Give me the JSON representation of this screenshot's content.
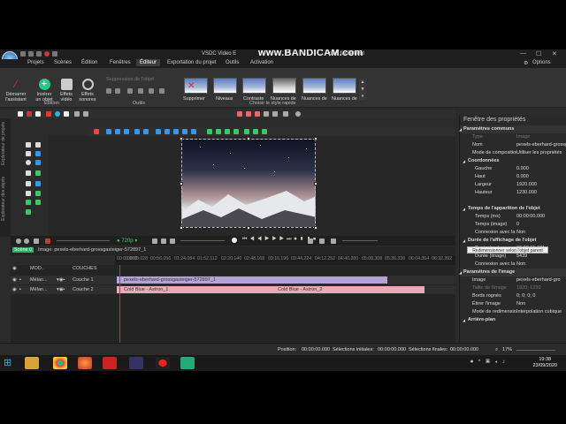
{
  "window": {
    "title": "VSDC Video E",
    "watermark": "www.BANDICAM.com",
    "title_suffix": "plus facilement"
  },
  "menu_tabs": [
    "Projets",
    "Scènes",
    "Édition",
    "Fenêtres",
    "Éditeur",
    "Exportation du projet",
    "Outils",
    "Activation"
  ],
  "support_label": "Options",
  "ribbon": {
    "buttons": [
      {
        "label": "Démarrer\nl'assistant",
        "color": "#d33"
      },
      {
        "label": "Insérer\nun objet",
        "color": "#2c8"
      },
      {
        "label": "Effets\nvidéo",
        "color": "#ccc"
      },
      {
        "label": "Effets\nsonores",
        "color": "#ccc"
      }
    ],
    "group_edition": "Édition",
    "group_outils": "Outils",
    "group_style": "Choisir le style rapide",
    "prop_hint": "Suppression de l'objet",
    "styles": [
      {
        "label": "Supprimer",
        "gray": false
      },
      {
        "label": "Niveaux",
        "gray": false
      },
      {
        "label": "Contraste",
        "gray": false
      },
      {
        "label": "Nuances de",
        "gray": true
      },
      {
        "label": "Nuances de",
        "gray": false
      },
      {
        "label": "Nuances de",
        "gray": false
      }
    ]
  },
  "left_panel": {
    "vertical_tabs": [
      "Explorateur de projets",
      "Explorateur des objets"
    ]
  },
  "playback": {
    "zoom": "720p"
  },
  "scene_tabs": {
    "scene": "Scène 0",
    "image": "Image: pexels-eberhard-grossgasteiger-572897_1"
  },
  "ruler_ticks": [
    "00:00.000",
    "00:08.028",
    "00:56.056",
    "01:24.084",
    "01:52.112",
    "02:20.140",
    "02:48.168",
    "03:16.196",
    "03:44.224",
    "04:12.252",
    "04:40.280",
    "05:08.308",
    "05:36.336",
    "06:04.364",
    "06:32.392"
  ],
  "timeline": {
    "header": {
      "mode": "MOD..",
      "layers": "COUCHES"
    },
    "rows": [
      {
        "type": "Mélan...",
        "name": "Couche 1"
      },
      {
        "type": "Mélan...",
        "name": "Couche 2"
      }
    ],
    "clips": {
      "image": "pexels-eberhard-grossgasteiger-572897_1",
      "audio1": "Cold Blue - Astron_1",
      "audio2": "Cold Blue - Astron_2"
    }
  },
  "status": {
    "position_label": "Position:",
    "position_value": "00:00:00.000",
    "sel_start_label": "Sélections initiales:",
    "sel_start_value": "00:00:00.000",
    "sel_end_label": "Sélections finales:",
    "sel_end_value": "00:00:00.000",
    "zoom": "17%"
  },
  "properties": {
    "title": "Fenêtre des propriétés",
    "rows": [
      {
        "kind": "sec",
        "k": "Paramètres communs",
        "v": ""
      },
      {
        "kind": "dim",
        "k": "Type",
        "v": "Image"
      },
      {
        "kind": "",
        "k": "Nom",
        "v": "pexels-eberhard-grossg"
      },
      {
        "kind": "",
        "k": "Mode de composition",
        "v": "Utiliser les propriétés"
      },
      {
        "kind": "sub",
        "k": "Coordonnées",
        "v": ""
      },
      {
        "kind": "ind",
        "k": "Gauche",
        "v": "0.000"
      },
      {
        "kind": "ind",
        "k": "Haut",
        "v": "0.000"
      },
      {
        "kind": "ind",
        "k": "Largeur",
        "v": "1920.000"
      },
      {
        "kind": "ind",
        "k": "Hauteur",
        "v": "1230.000"
      },
      {
        "kind": "btn",
        "k": "",
        "v": ""
      },
      {
        "kind": "sub",
        "k": "Temps de l'apparition de l'objet",
        "v": ""
      },
      {
        "kind": "ind",
        "k": "Temps (ms)",
        "v": "00:00:00.000"
      },
      {
        "kind": "ind",
        "k": "Temps (image)",
        "v": "0"
      },
      {
        "kind": "ind",
        "k": "Connexion avec la",
        "v": "Non"
      },
      {
        "kind": "sub",
        "k": "Durée de l'affichage de l'objet",
        "v": ""
      },
      {
        "kind": "ind",
        "k": "Durée (ms)",
        "v": "00:03:01.481"
      },
      {
        "kind": "ind",
        "k": "Durée (image)",
        "v": "5439"
      },
      {
        "kind": "ind",
        "k": "Connexion avec la",
        "v": "Non"
      },
      {
        "kind": "sec",
        "k": "Paramètres de l'image",
        "v": ""
      },
      {
        "kind": "",
        "k": "Image",
        "v": "pexels-eberhard-gro"
      },
      {
        "kind": "dim",
        "k": "Taille de l'image",
        "v": "1920; 1230"
      },
      {
        "kind": "",
        "k": "Bords rognés",
        "v": "0; 0; 0; 0"
      },
      {
        "kind": "",
        "k": "Étirer l'image",
        "v": "Non"
      },
      {
        "kind": "",
        "k": "Mode de redimension",
        "v": "Interpolation cubique"
      },
      {
        "kind": "sub",
        "k": "Arrière-plan",
        "v": ""
      }
    ],
    "resize_button": "Redimensionner selon l'objet parent"
  },
  "clock": {
    "time": "19:38",
    "date": "23/09/2020"
  }
}
